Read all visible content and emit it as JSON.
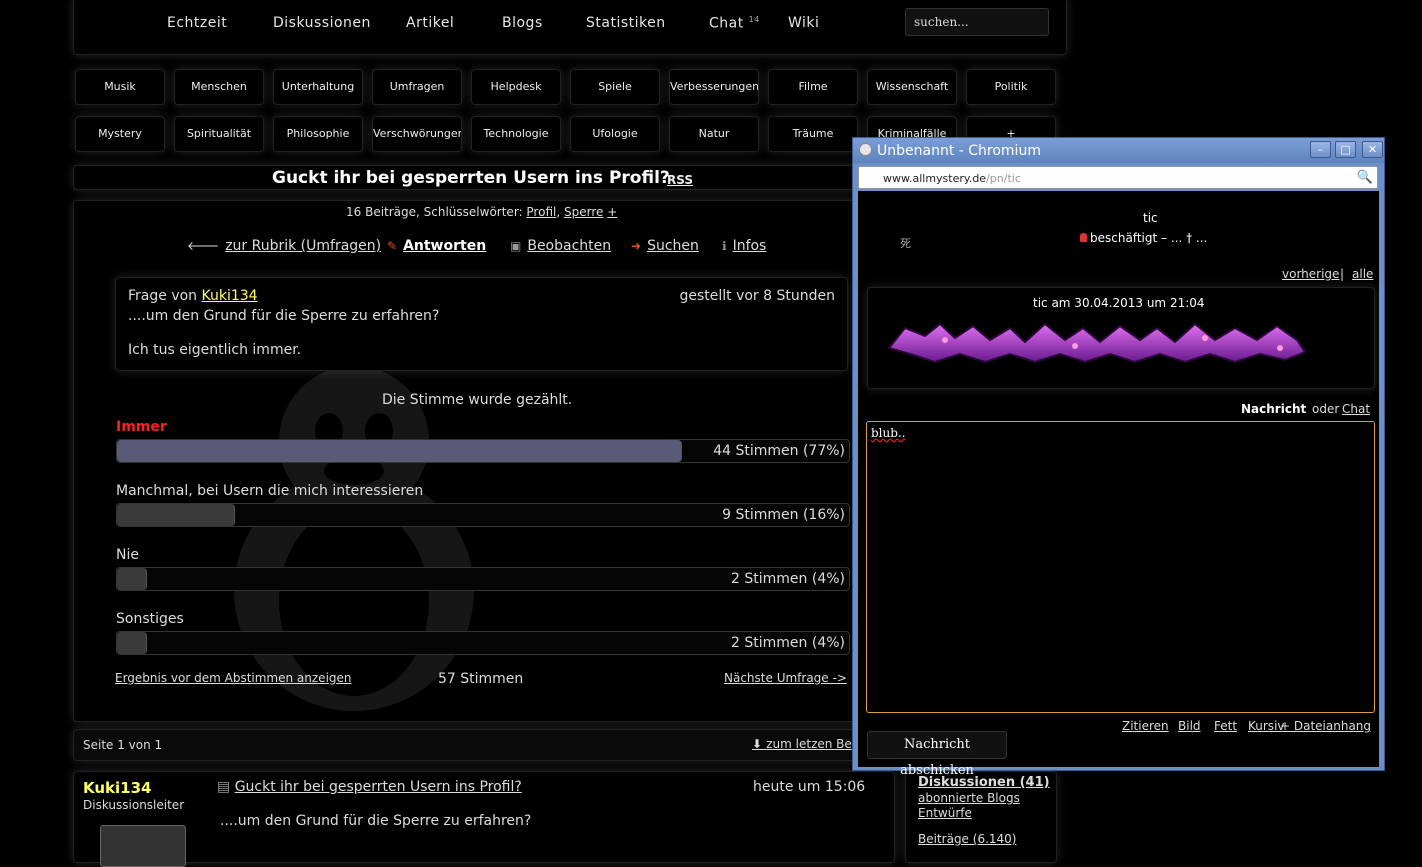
{
  "nav": {
    "items": [
      {
        "label": "Echtzeit"
      },
      {
        "label": "Diskussionen"
      },
      {
        "label": "Artikel"
      },
      {
        "label": "Blogs"
      },
      {
        "label": "Statistiken"
      },
      {
        "label": "Chat",
        "badge": "14"
      },
      {
        "label": "Wiki"
      }
    ],
    "search_placeholder": "suchen..."
  },
  "categories": {
    "row1": [
      "Musik",
      "Menschen",
      "Unterhaltung",
      "Umfragen",
      "Helpdesk",
      "Spiele",
      "Verbesserungen",
      "Filme",
      "Wissenschaft",
      "Politik"
    ],
    "row2": [
      "Mystery",
      "Spiritualität",
      "Philosophie",
      "Verschwörungen",
      "Technologie",
      "Ufologie",
      "Natur",
      "Träume",
      "Kriminalfälle",
      "+"
    ]
  },
  "thread": {
    "title": "Guckt ihr bei gesperrten Usern ins Profil?",
    "rss": "RSS",
    "tags_prefix": "16 Beiträge, Schlüsselwörter:",
    "tag1": "Profil",
    "tag2": "Sperre",
    "tag_more": "+"
  },
  "actions": {
    "back": "zur Rubrik (Umfragen)",
    "reply": "Antworten",
    "watch": "Beobachten",
    "search": "Suchen",
    "info": "Infos"
  },
  "question": {
    "from_prefix": "Frage von",
    "author": "Kuki134",
    "time": "gestellt vor 8 Stunden",
    "text1": "....um den Grund für die Sperre zu erfahren?",
    "text2": "Ich tus eigentlich immer."
  },
  "poll": {
    "vote_counted": "Die Stimme wurde gezählt.",
    "options": [
      {
        "label": "Immer",
        "result": "44 Stimmen (77%)",
        "fraction": 0.77,
        "voted": true
      },
      {
        "label": "Manchmal, bei Usern die mich interessieren",
        "result": "9 Stimmen (16%)",
        "fraction": 0.16,
        "voted": false
      },
      {
        "label": "Nie",
        "result": "2 Stimmen (4%)",
        "fraction": 0.04,
        "voted": false
      },
      {
        "label": "Sonstiges",
        "result": "2 Stimmen (4%)",
        "fraction": 0.04,
        "voted": false
      }
    ],
    "show_results_link": "Ergebnis vor dem Abstimmen anzeigen",
    "total": "57 Stimmen",
    "next_poll": "Nächste Umfrage ->"
  },
  "pager": {
    "page_info": "Seite 1 von 1",
    "to_last": "zum letzen Be"
  },
  "post": {
    "user": "Kuki134",
    "role": "Diskussionsleiter",
    "title": "Guckt ihr bei gesperrten Usern ins Profil?",
    "time": "heute um 15:06",
    "text": "....um den Grund für die Sperre zu erfahren?"
  },
  "sidebar": {
    "discussions": "Diskussionen (41)",
    "subscribed_blogs": "abonnierte Blogs",
    "drafts": "Entwürfe",
    "posts": "Beiträge (6.140)"
  },
  "popup": {
    "window_title": "Unbenannt - Chromium",
    "url_host": "www.allmystery.de",
    "url_path": "/pn/tic",
    "user": "tic",
    "glyph": "死",
    "status": "beschäftigt – ... † ...",
    "prev": "vorherige",
    "sep": "|",
    "all": "alle",
    "msg_header": "tic am 30.04.2013 um 21:04",
    "compose_label": "Nachricht",
    "compose_or": "oder",
    "compose_chat": "Chat",
    "message_text": "blub..",
    "format_links": [
      "Zitieren",
      "Bild",
      "Fett",
      "Kursiv",
      "+ Dateianhang"
    ],
    "send": "Nachricht abschicken"
  },
  "colors": {
    "accent_yellow": "#ffff66",
    "voted_red": "#ff2020",
    "bar_voted": "#5a5a78",
    "bar_default": "#3a3a3a",
    "window_chrome": "#6b8fc7"
  }
}
